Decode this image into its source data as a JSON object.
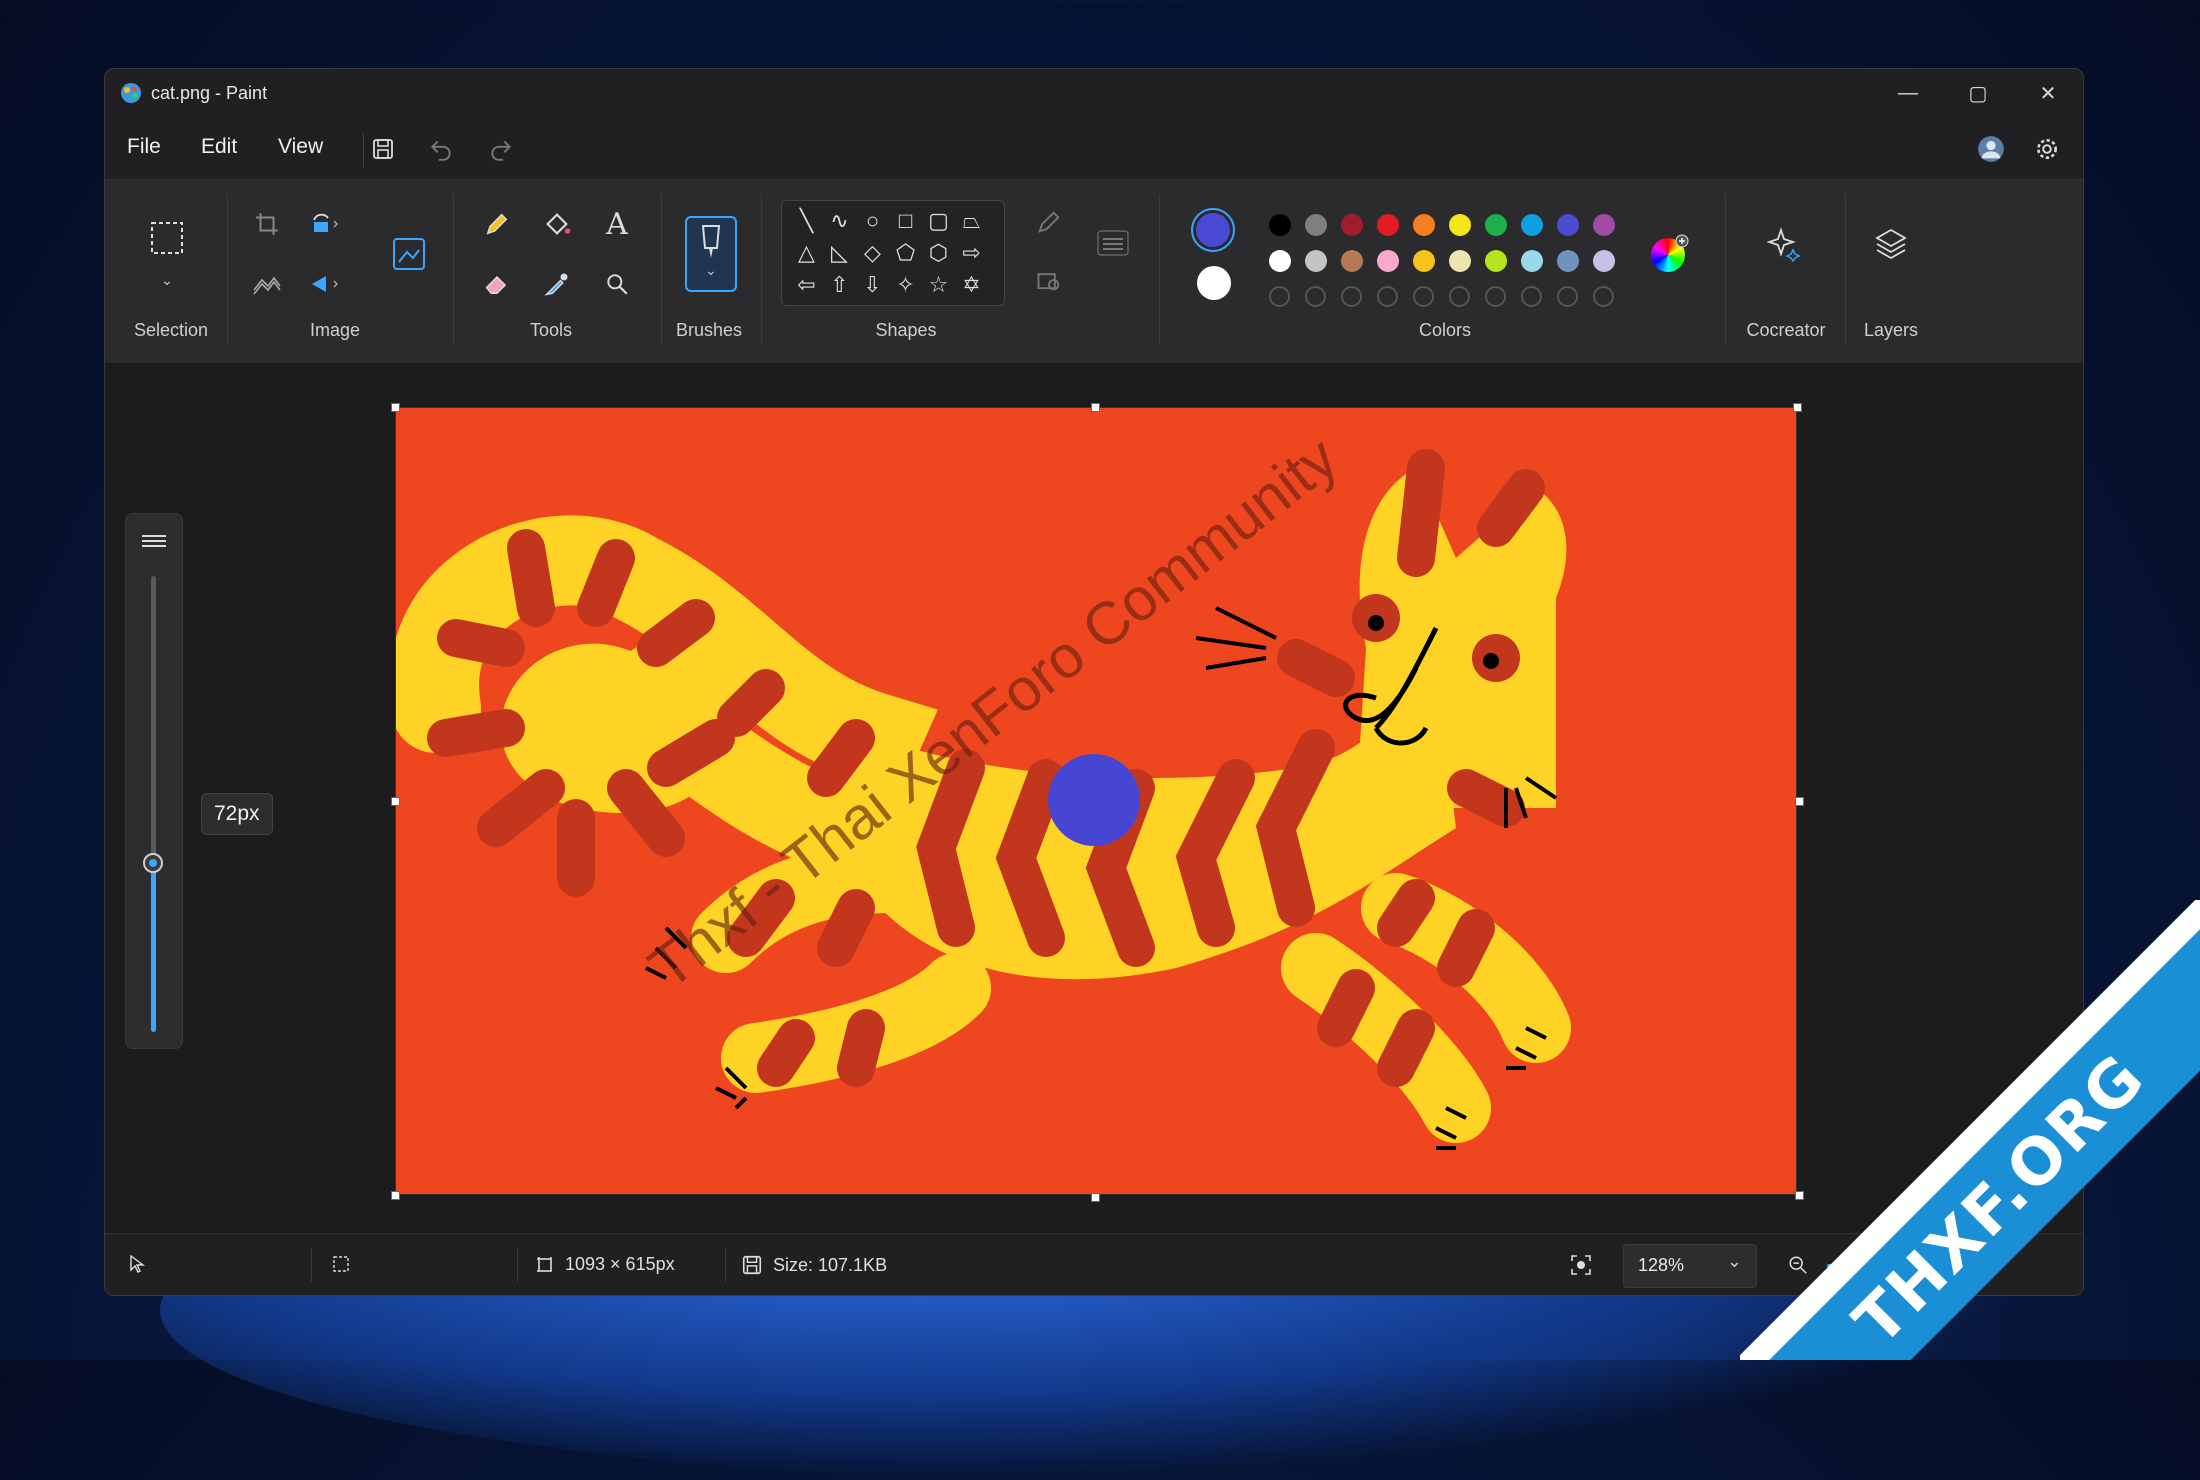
{
  "window": {
    "title": "cat.png - Paint",
    "controls": {
      "minimize": "—",
      "maximize": "▢",
      "close": "✕"
    }
  },
  "menu": {
    "file": "File",
    "edit": "Edit",
    "view": "View"
  },
  "ribbon": {
    "groups": {
      "selection": "Selection",
      "image": "Image",
      "tools": "Tools",
      "brushes": "Brushes",
      "shapes": "Shapes",
      "colors": "Colors",
      "cocreator": "Cocreator",
      "layers": "Layers"
    },
    "shapes_glyphs": [
      "╲",
      "∿",
      "○",
      "□",
      "▢",
      "⏢",
      "△",
      "◺",
      "◇",
      "⬠",
      "⬡",
      "⇨",
      "⇦",
      "⇧",
      "⇩",
      "✧",
      "☆",
      "✡"
    ],
    "colors": {
      "primary": "#4a4ad6",
      "secondary": "#ffffff",
      "row1": [
        "#000000",
        "#7f7f7f",
        "#a01e2a",
        "#e21b23",
        "#f57f1e",
        "#f7e51b",
        "#1eb04b",
        "#0e9fe2",
        "#4b4ccf",
        "#a04ca2"
      ],
      "row2": [
        "#ffffff",
        "#c3c3c3",
        "#b57a52",
        "#f8aac8",
        "#f7c21b",
        "#efe4b0",
        "#b5e61d",
        "#99d9ea",
        "#7092be",
        "#c8bfe7"
      ]
    }
  },
  "sidebar": {
    "brush_size": "72px",
    "brush_size_fraction": 0.37
  },
  "canvas": {
    "background": "#ee4720",
    "watermark": "Thxf - Thai XenForo Community"
  },
  "status": {
    "dimensions": "1093 × 615px",
    "size": "Size: 107.1KB",
    "zoom": "128%"
  },
  "badge": {
    "text": "THXF.ORG"
  }
}
